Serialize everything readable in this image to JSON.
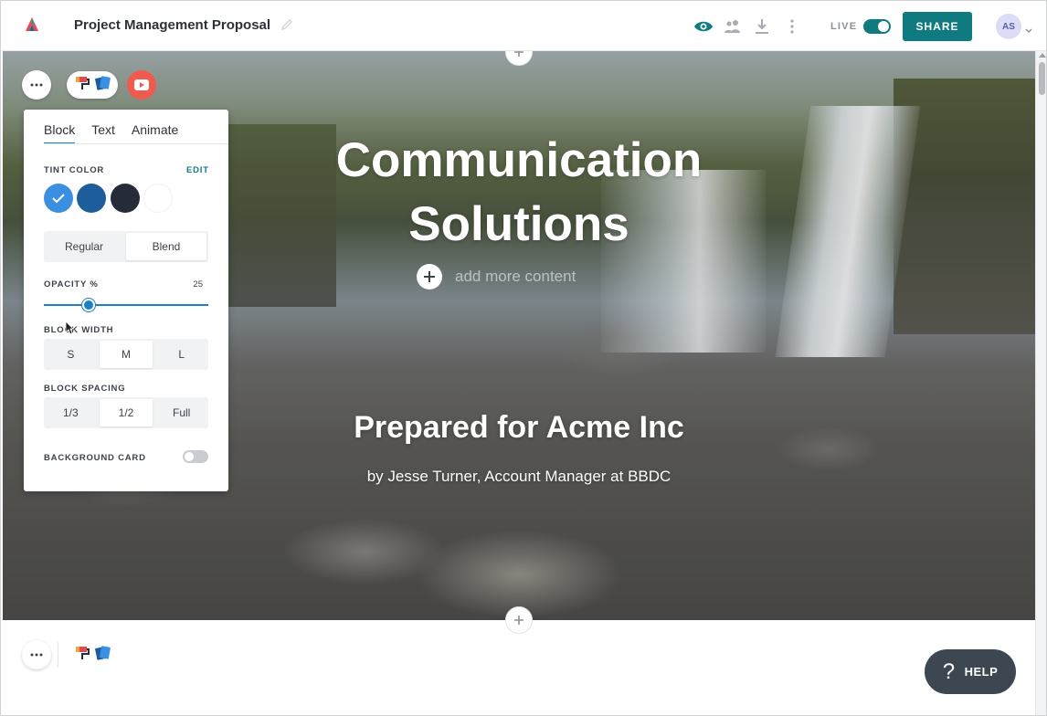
{
  "topbar": {
    "doc_title": "Project Management Proposal",
    "live_label": "LIVE",
    "share_label": "SHARE",
    "avatar_initials": "AS",
    "icons": [
      "logo-icon",
      "edit-pencil-icon",
      "preview-eye-icon",
      "people-icon",
      "download-icon",
      "more-vertical-icon",
      "chevron-down-icon"
    ]
  },
  "hero": {
    "title_line1": "Communication",
    "title_line2": "Solutions",
    "add_content_placeholder": "add more content",
    "subtitle": "Prepared for Acme Inc",
    "byline": "by Jesse Turner, Account Manager at BBDC"
  },
  "panel": {
    "tabs": [
      "Block",
      "Text",
      "Animate"
    ],
    "active_tab": "Block",
    "tint_color_label": "TINT COLOR",
    "edit_label": "EDIT",
    "tint_swatches": [
      "#3b8fe0",
      "#1d5d9c",
      "#252b39",
      "#ffffff"
    ],
    "selected_swatch": "#3b8fe0",
    "blend_modes": [
      "Regular",
      "Blend"
    ],
    "selected_blend_mode": "Blend",
    "opacity_label": "OPACITY %",
    "opacity_value": "25",
    "block_width_label": "BLOCK WIDTH",
    "width_options": [
      "S",
      "M",
      "L"
    ],
    "selected_width": "M",
    "block_spacing_label": "BLOCK SPACING",
    "spacing_options": [
      "1/3",
      "1/2",
      "Full"
    ],
    "selected_spacing": "1/2",
    "background_card_label": "BACKGROUND CARD",
    "background_card_on": false
  },
  "section2": {
    "heading_fragment": "...."
  },
  "help": {
    "label": "HELP"
  },
  "colors": {
    "accent_teal": "#0f7a7f",
    "accent_blue": "#1b7fc4",
    "youtube_red": "#f05a4f"
  }
}
